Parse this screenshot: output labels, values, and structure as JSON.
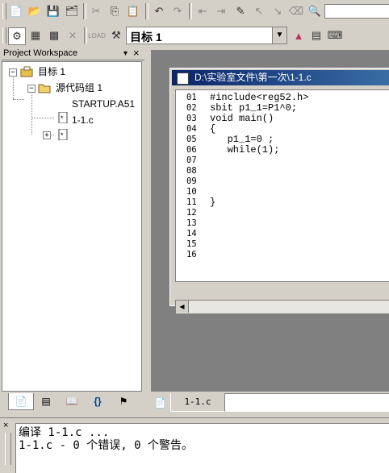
{
  "toolbar1": {
    "search_value": ""
  },
  "toolbar2": {
    "target_value": "目标 1"
  },
  "workspace": {
    "title": "Project Workspace",
    "pin": "▾",
    "close": "×",
    "tree": {
      "target": "目标 1",
      "group": "源代码组 1",
      "files": [
        "STARTUP.A51",
        "1-1.c"
      ]
    }
  },
  "editor": {
    "title": "D:\\实验室文件\\第一次\\1-1.c",
    "line_numbers": [
      "01",
      "02",
      "03",
      "04",
      "05",
      "06",
      "07",
      "08",
      "09",
      "10",
      "11",
      "12",
      "13",
      "14",
      "15",
      "16"
    ],
    "lines": [
      "#include<reg52.h>",
      "sbit p1_1=P1^0;",
      "void main()",
      "{",
      "   p1_1=0 ;",
      "   while(1);",
      "",
      "",
      "",
      "",
      "}",
      "",
      "",
      "",
      "",
      ""
    ]
  },
  "doc_tabs": {
    "active": "1-1.c"
  },
  "output": {
    "lines": [
      "编译 1-1.c ...",
      "1-1.c - 0 个错误, 0 个警告。"
    ]
  }
}
